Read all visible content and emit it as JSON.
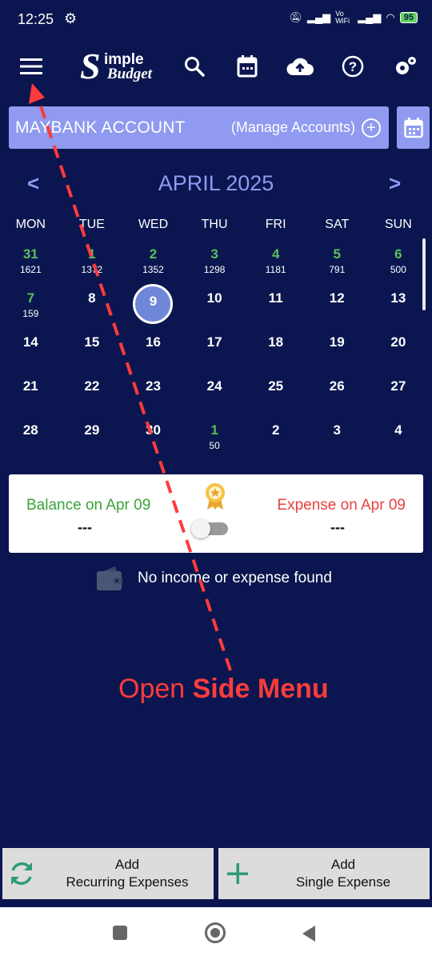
{
  "status_bar": {
    "time": "12:25",
    "network": "Vo WiFi",
    "battery": "95"
  },
  "account": {
    "name": "MAYBANK ACCOUNT",
    "manage_label": "(Manage Accounts)"
  },
  "calendar": {
    "month_title": "APRIL 2025",
    "prev": "<",
    "next": ">",
    "weekdays": [
      "MON",
      "TUE",
      "WED",
      "THU",
      "FRI",
      "SAT",
      "SUN"
    ],
    "weeks": [
      [
        {
          "day": "31",
          "amount": "1621",
          "green": true
        },
        {
          "day": "1",
          "amount": "1372",
          "green": true
        },
        {
          "day": "2",
          "amount": "1352",
          "green": true
        },
        {
          "day": "3",
          "amount": "1298",
          "green": true
        },
        {
          "day": "4",
          "amount": "1181",
          "green": true
        },
        {
          "day": "5",
          "amount": "791",
          "green": true
        },
        {
          "day": "6",
          "amount": "500",
          "green": true
        }
      ],
      [
        {
          "day": "7",
          "amount": "159",
          "green": true
        },
        {
          "day": "8",
          "amount": ""
        },
        {
          "day": "9",
          "amount": "",
          "selected": true
        },
        {
          "day": "10",
          "amount": ""
        },
        {
          "day": "11",
          "amount": ""
        },
        {
          "day": "12",
          "amount": ""
        },
        {
          "day": "13",
          "amount": ""
        }
      ],
      [
        {
          "day": "14",
          "amount": ""
        },
        {
          "day": "15",
          "amount": ""
        },
        {
          "day": "16",
          "amount": ""
        },
        {
          "day": "17",
          "amount": ""
        },
        {
          "day": "18",
          "amount": ""
        },
        {
          "day": "19",
          "amount": ""
        },
        {
          "day": "20",
          "amount": ""
        }
      ],
      [
        {
          "day": "21",
          "amount": ""
        },
        {
          "day": "22",
          "amount": ""
        },
        {
          "day": "23",
          "amount": ""
        },
        {
          "day": "24",
          "amount": ""
        },
        {
          "day": "25",
          "amount": ""
        },
        {
          "day": "26",
          "amount": ""
        },
        {
          "day": "27",
          "amount": ""
        }
      ],
      [
        {
          "day": "28",
          "amount": ""
        },
        {
          "day": "29",
          "amount": ""
        },
        {
          "day": "30",
          "amount": ""
        },
        {
          "day": "1",
          "amount": "50",
          "green": true
        },
        {
          "day": "2",
          "amount": ""
        },
        {
          "day": "3",
          "amount": ""
        },
        {
          "day": "4",
          "amount": ""
        }
      ]
    ]
  },
  "summary": {
    "balance_label": "Balance on Apr 09",
    "balance_value": "---",
    "expense_label": "Expense on Apr 09",
    "expense_value": "---"
  },
  "empty_state": {
    "text": "No income or expense found"
  },
  "annotation": {
    "prefix": "Open ",
    "bold": "Side Menu"
  },
  "buttons": {
    "recurring": {
      "line1": "Add",
      "line2": "Recurring Expenses"
    },
    "single": {
      "line1": "Add",
      "line2": "Single Expense"
    }
  },
  "colors": {
    "background": "#0b1650",
    "accent": "#8f9af0",
    "income": "#3aa33a",
    "expense": "#e84040",
    "annotation": "#ff3b3b"
  },
  "icons": [
    "menu-icon",
    "search-icon",
    "calendar-icon",
    "cloud-upload-icon",
    "help-icon",
    "settings-icon",
    "add-circle-icon",
    "wallet-icon",
    "medal-icon",
    "refresh-icon",
    "plus-icon"
  ]
}
